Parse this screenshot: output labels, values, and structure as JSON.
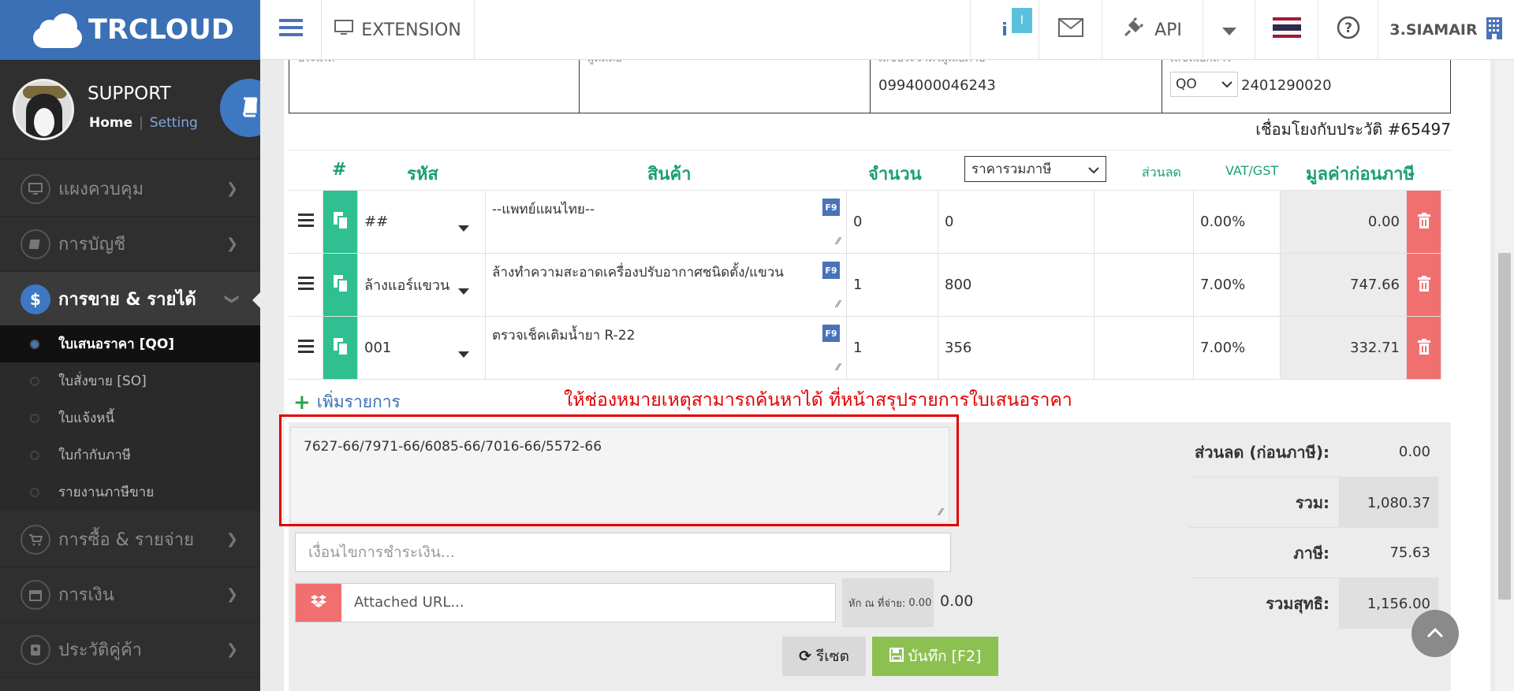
{
  "brand": {
    "logo_text": "TRCLOUD"
  },
  "topbar": {
    "extension_label": "EXTENSION",
    "api_label": "API",
    "company": "3.SIAMAIR",
    "notif_badge": "I"
  },
  "user": {
    "name": "SUPPORT",
    "home_link": "Home",
    "separator": "|",
    "setting_link": "Setting"
  },
  "sidebar": {
    "menu": [
      {
        "label": "แผงควบคุม",
        "icon": "monitor-icon"
      },
      {
        "label": "การบัญชี",
        "icon": "book-icon"
      },
      {
        "label": "การขาย & รายได้",
        "icon": "dollar-icon"
      },
      {
        "label": "การซื้อ & รายจ่าย",
        "icon": "cart-icon"
      },
      {
        "label": "การเงิน",
        "icon": "calendar-icon"
      },
      {
        "label": "ประวัติคู่ค้า",
        "icon": "contact-icon"
      }
    ],
    "sub": [
      "ใบเสนอราคา [QO]",
      "ใบสั่งขาย [SO]",
      "ใบแจ้งหนี้",
      "ใบกำกับภาษี",
      "รายงานภาษีขาย"
    ]
  },
  "doc": {
    "tax_id": "0994000046243",
    "doc_prefix": "QO",
    "doc_number": "2401290020",
    "link_text": "เชื่อมโยงกับประวัติ #65497",
    "top_labels": [
      "ประเภท",
      "ผู้ติดต่อ",
      "เลขประจำตัวผู้เสียภาษี",
      "เลขที่เอกสาร"
    ]
  },
  "table": {
    "headers": {
      "num": "#",
      "code": "รหัส",
      "product": "สินค้า",
      "qty": "จำนวน",
      "price_mode": "ราคารวมภาษี",
      "discount": "ส่วนลด",
      "vat": "VAT/GST",
      "value": "มูลค่าก่อนภาษี"
    },
    "rows": [
      {
        "code": "##",
        "desc": "--แพทย์แผนไทย--",
        "qty": "0",
        "price": "0",
        "vat": "0.00%",
        "value": "0.00"
      },
      {
        "code": "ล้างแอร์แขวน",
        "desc": "ล้างทำความสะอาดเครื่องปรับอากาศชนิดตั้ง/แขวน",
        "qty": "1",
        "price": "800",
        "vat": "7.00%",
        "value": "747.66"
      },
      {
        "code": "001",
        "desc": "ตรวจเช็คเติมน้ำยา R-22",
        "qty": "1",
        "price": "356",
        "vat": "7.00%",
        "value": "332.71"
      }
    ],
    "f9_label": "F9",
    "add_item": "เพิ่มรายการ"
  },
  "annotation": "ให้ช่องหมายเหตุสามารถค้นหาได้ ที่หน้าสรุปรายการใบเสนอราคา",
  "note": "7627-66/7971-66/6085-66/7016-66/5572-66",
  "payment_placeholder": "เงื่อนไขการชำระเงิน...",
  "attached_url": "Attached URL...",
  "withholding": {
    "label": "หัก ณ ที่จ่าย:",
    "value_small": "0.00",
    "value": "0.00"
  },
  "summary": [
    {
      "label": "ส่วนลด (ก่อนภาษี):",
      "value": "0.00"
    },
    {
      "label": "รวม:",
      "value": "1,080.37"
    },
    {
      "label": "ภาษี:",
      "value": "75.63"
    },
    {
      "label": "รวมสุทธิ:",
      "value": "1,156.00"
    }
  ],
  "buttons": {
    "reset": "รีเซต",
    "save": "บันทึก [F2]"
  },
  "colors": {
    "brand": "#3b6fb6",
    "teal": "#1a9e78",
    "red_annotation": "#e00000",
    "delete": "#f07070",
    "save": "#8cc152"
  }
}
